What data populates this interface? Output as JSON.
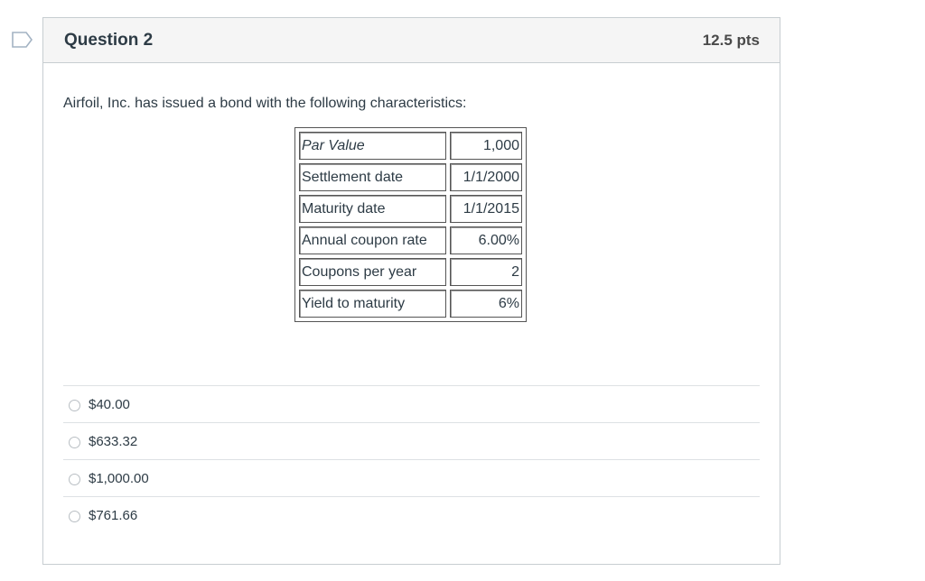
{
  "question": {
    "title": "Question 2",
    "points": "12.5 pts",
    "text": "Airfoil, Inc. has issued a bond with the following characteristics:",
    "table": [
      {
        "label": "Par Value",
        "value": "1,000",
        "italic": true
      },
      {
        "label": "Settlement date",
        "value": "1/1/2000"
      },
      {
        "label": "Maturity date",
        "value": "1/1/2015"
      },
      {
        "label": "Annual coupon rate",
        "value": "6.00%"
      },
      {
        "label": "Coupons per year",
        "value": "2"
      },
      {
        "label": "Yield to maturity",
        "value": "6%"
      }
    ],
    "answers": [
      {
        "label": "$40.00",
        "selected": false
      },
      {
        "label": "$633.32",
        "selected": false
      },
      {
        "label": "$1,000.00",
        "selected": false
      },
      {
        "label": "$761.66",
        "selected": false
      }
    ]
  },
  "icons": {
    "flag": "flag-question-icon"
  }
}
